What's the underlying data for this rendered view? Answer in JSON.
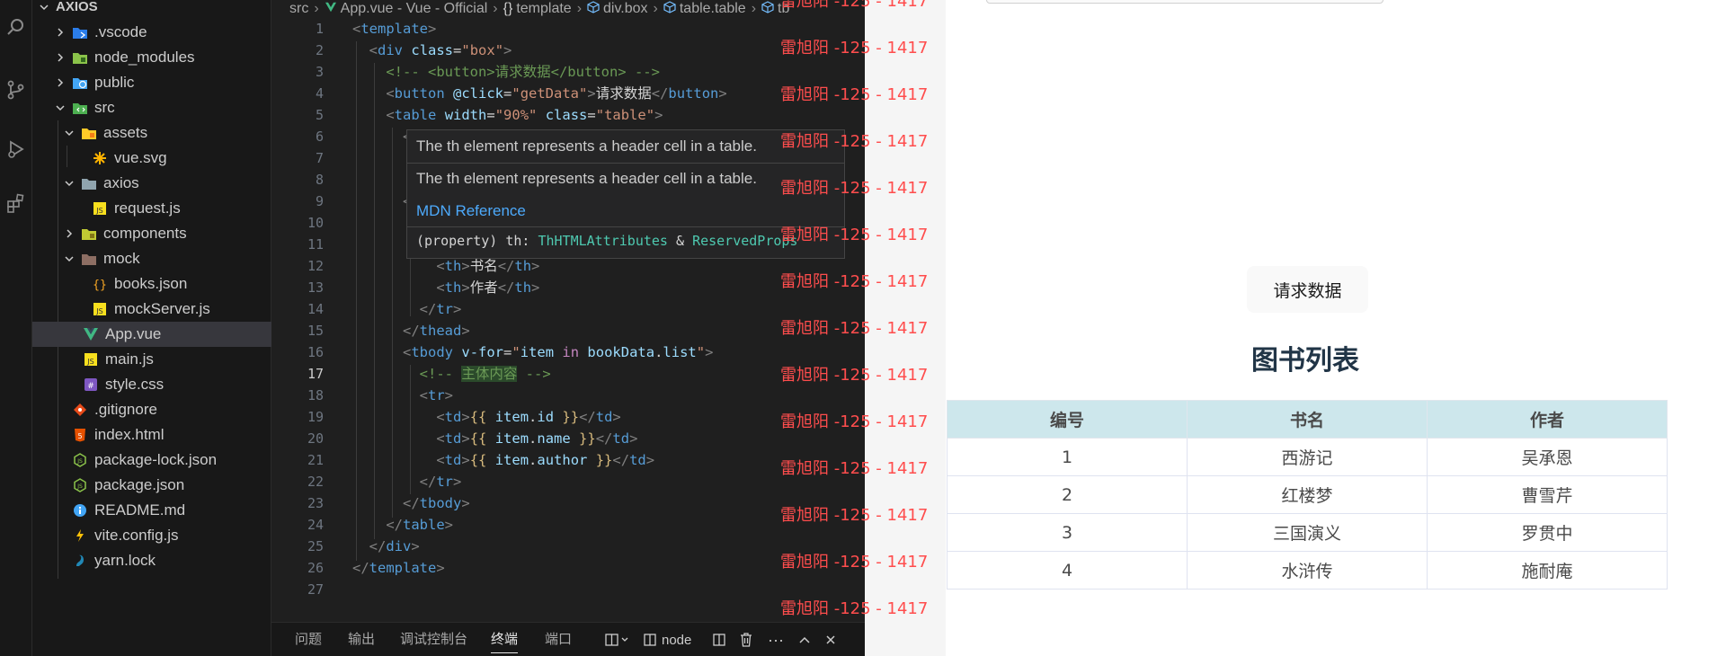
{
  "explorer": {
    "root": "AXIOS",
    "items": [
      {
        "label": ".vscode",
        "icon": "vscode-folder-icon"
      },
      {
        "label": "node_modules",
        "icon": "node-folder-icon"
      },
      {
        "label": "public",
        "icon": "public-folder-icon"
      },
      {
        "label": "src",
        "icon": "src-folder-icon"
      },
      {
        "label": "assets",
        "icon": "assets-folder-icon"
      },
      {
        "label": "vue.svg",
        "icon": "svg-file-icon"
      },
      {
        "label": "axios",
        "icon": "folder-icon"
      },
      {
        "label": "request.js",
        "icon": "js-file-icon"
      },
      {
        "label": "components",
        "icon": "components-folder-icon"
      },
      {
        "label": "mock",
        "icon": "mock-folder-icon"
      },
      {
        "label": "books.json",
        "icon": "json-file-icon"
      },
      {
        "label": "mockServer.js",
        "icon": "js-file-icon"
      },
      {
        "label": "App.vue",
        "icon": "vue-file-icon"
      },
      {
        "label": "main.js",
        "icon": "js-file-icon"
      },
      {
        "label": "style.css",
        "icon": "css-file-icon"
      },
      {
        "label": ".gitignore",
        "icon": "git-file-icon"
      },
      {
        "label": "index.html",
        "icon": "html-file-icon"
      },
      {
        "label": "package-lock.json",
        "icon": "nodejs-file-icon"
      },
      {
        "label": "package.json",
        "icon": "nodejs-file-icon"
      },
      {
        "label": "README.md",
        "icon": "info-file-icon"
      },
      {
        "label": "vite.config.js",
        "icon": "vite-file-icon"
      },
      {
        "label": "yarn.lock",
        "icon": "yarn-file-icon"
      }
    ]
  },
  "breadcrumb": {
    "src": "src",
    "file": "App.vue - Vue - Official",
    "template": "template",
    "div": "div.box",
    "table": "table.table",
    "tail": "tb"
  },
  "editor": {
    "line_numbers": [
      "1",
      "2",
      "3",
      "4",
      "5",
      "6",
      "7",
      "8",
      "9",
      "10",
      "11",
      "12",
      "13",
      "14",
      "15",
      "16",
      "17",
      "18",
      "19",
      "20",
      "21",
      "22",
      "23",
      "24",
      "25",
      "26",
      "27"
    ],
    "active_line": "17"
  },
  "hover": {
    "desc1": "The th element represents a header cell in a table.",
    "desc2": "The th element represents a header cell in a table.",
    "link": "MDN Reference",
    "sig_prefix": "(property) th: ",
    "sig_type1": "ThHTMLAttributes",
    "sig_amp": " & ",
    "sig_type2": "ReservedProps"
  },
  "watermark": "雷旭阳 -125 - 1417",
  "panel": {
    "tabs": [
      "问题",
      "输出",
      "调试控制台",
      "终端",
      "端口"
    ],
    "active_tab": "终端",
    "terminal_name": "node"
  },
  "preview": {
    "button_label": "请求数据",
    "title": "图书列表",
    "headers": [
      "编号",
      "书名",
      "作者"
    ],
    "rows": [
      [
        "1",
        "西游记",
        "吴承恩"
      ],
      [
        "2",
        "红楼梦",
        "曹雪芹"
      ],
      [
        "3",
        "三国演义",
        "罗贯中"
      ],
      [
        "4",
        "水浒传",
        "施耐庵"
      ]
    ]
  },
  "colors": {
    "accent_blue": "#4daafc",
    "watermark_red": "#ff4d4d",
    "table_header_bg": "#cde7ec"
  }
}
